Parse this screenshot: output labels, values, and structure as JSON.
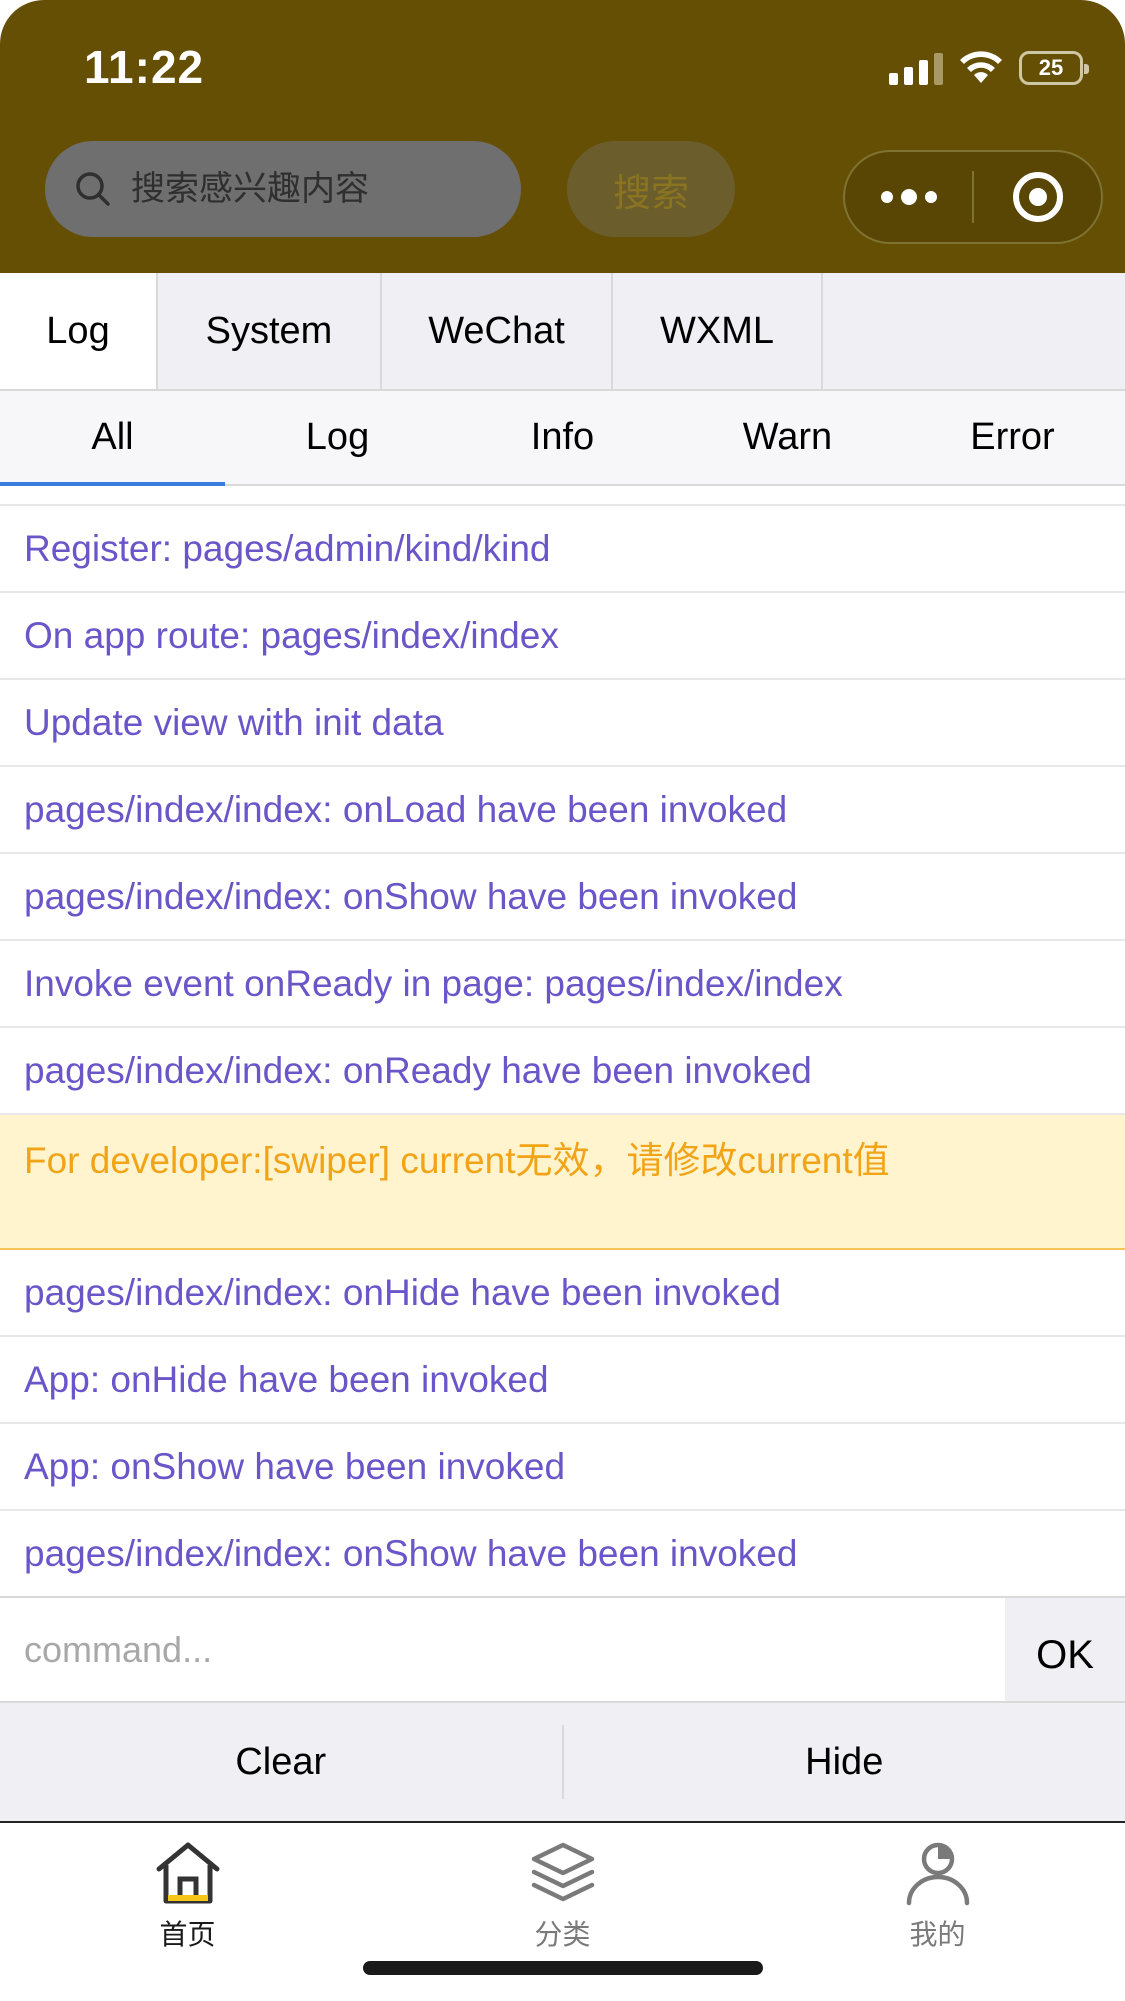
{
  "status_bar": {
    "time": "11:22",
    "battery": "25"
  },
  "header": {
    "search_placeholder": "搜索感兴趣内容",
    "search_button": "搜索",
    "bg_color": "#654f04"
  },
  "top_tabs": [
    {
      "label": "Log"
    },
    {
      "label": "System"
    },
    {
      "label": "WeChat"
    },
    {
      "label": "WXML"
    }
  ],
  "filter_tabs": [
    {
      "label": "All"
    },
    {
      "label": "Log"
    },
    {
      "label": "Info"
    },
    {
      "label": "Warn"
    },
    {
      "label": "Error"
    }
  ],
  "logs": [
    {
      "text": "Register: pages/admin/kind/kind",
      "level": "log"
    },
    {
      "text": "On app route: pages/index/index",
      "level": "log"
    },
    {
      "text": "Update view with init data",
      "level": "log"
    },
    {
      "text": "pages/index/index: onLoad have been invoked",
      "level": "log"
    },
    {
      "text": "pages/index/index: onShow have been invoked",
      "level": "log"
    },
    {
      "text": "Invoke event onReady in page: pages/index/index",
      "level": "log"
    },
    {
      "text": "pages/index/index: onReady have been invoked",
      "level": "log"
    },
    {
      "text": "For developer:[swiper] current无效，请修改current值",
      "level": "warn"
    },
    {
      "text": "pages/index/index: onHide have been invoked",
      "level": "log"
    },
    {
      "text": "App: onHide have been invoked",
      "level": "log"
    },
    {
      "text": "App: onShow have been invoked",
      "level": "log"
    },
    {
      "text": "pages/index/index: onShow have been invoked",
      "level": "log"
    }
  ],
  "command": {
    "placeholder": "command...",
    "ok_label": "OK"
  },
  "actions": {
    "clear_label": "Clear",
    "hide_label": "Hide"
  },
  "tabbar": [
    {
      "label": "首页",
      "icon": "home-icon"
    },
    {
      "label": "分类",
      "icon": "layers-icon"
    },
    {
      "label": "我的",
      "icon": "user-icon"
    }
  ],
  "colors": {
    "log_text": "#6a56c8",
    "warn_text": "#f2a418",
    "warn_bg": "#fff4cd",
    "active_indicator": "#3b7ddd"
  }
}
